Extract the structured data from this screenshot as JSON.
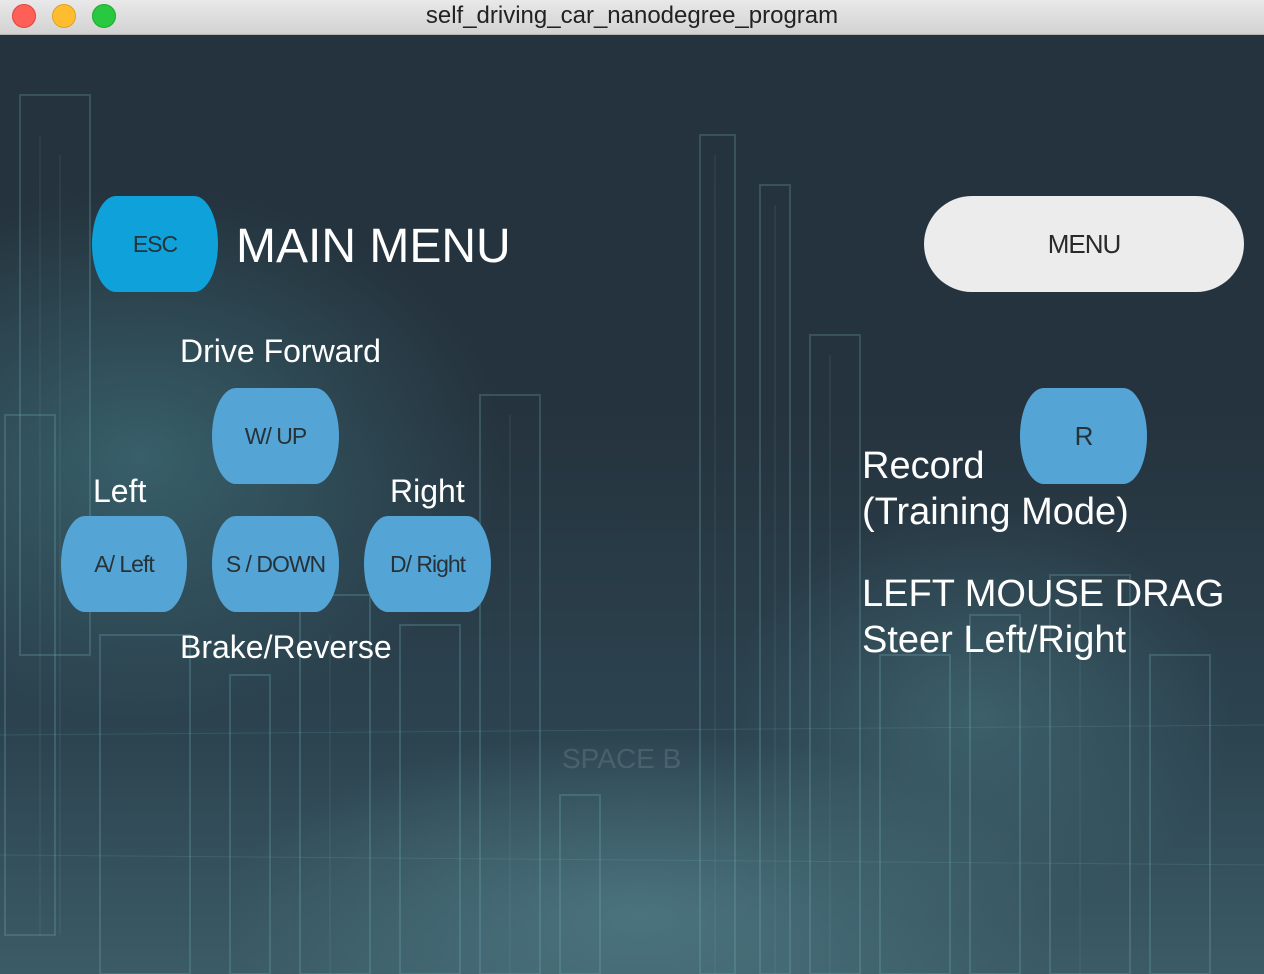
{
  "window": {
    "title": "self_driving_car_nanodegree_program"
  },
  "header": {
    "esc_key": "ESC",
    "title": "MAIN MENU",
    "menu_button": "MENU"
  },
  "controls": {
    "forward_label": "Drive Forward",
    "forward_key": "W/ UP",
    "left_label": "Left",
    "left_key": "A/ Left",
    "brake_key": "S / DOWN",
    "right_label": "Right",
    "right_key": "D/ Right",
    "brake_label": "Brake/Reverse"
  },
  "record": {
    "key": "R",
    "label": "Record",
    "sublabel": "(Training Mode)"
  },
  "mouse": {
    "title": "LEFT MOUSE DRAG",
    "description": "Steer Left/Right"
  },
  "faint_hint": "SPACE B",
  "colors": {
    "key_blue": "#55a4d6",
    "esc_blue": "#0fa2da",
    "menu_bg": "#ececec",
    "background": "#1f2a33"
  }
}
